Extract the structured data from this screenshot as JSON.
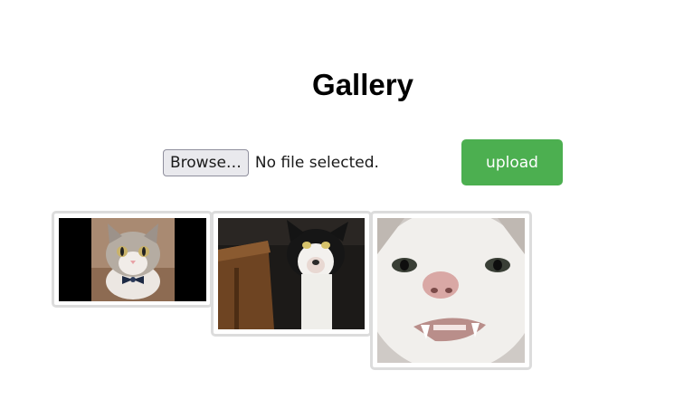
{
  "header": {
    "title": "Gallery"
  },
  "upload_form": {
    "browse_label": "Browse…",
    "file_status": "No file selected.",
    "upload_label": "upload",
    "upload_color": "#4caf50"
  },
  "gallery": {
    "images": [
      {
        "subject": "tabby-white cat wearing bow tie"
      },
      {
        "subject": "black and white cat looking down"
      },
      {
        "subject": "white cat close-up showing teeth"
      }
    ]
  }
}
